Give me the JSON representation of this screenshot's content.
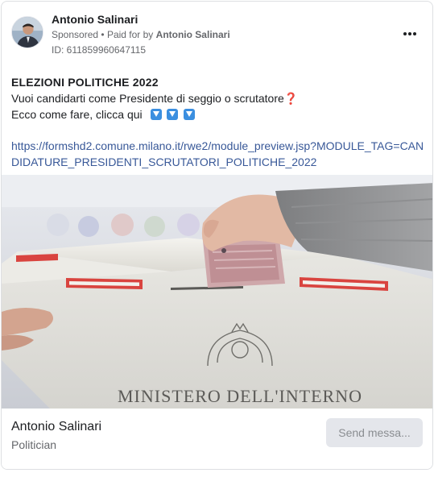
{
  "post": {
    "author_name": "Antonio Salinari",
    "sponsored_label": "Sponsored",
    "separator": "•",
    "paid_for_prefix": "Paid for by",
    "paid_for_name": "Antonio Salinari",
    "ad_id": "ID: 611859960647115",
    "more_icon": "more-horizontal-icon"
  },
  "content": {
    "title": "ELEZIONI POLITICHE 2022",
    "line1": "Vuoi candidarti come Presidente di seggio o scrutatore",
    "line1_emoji": "❓",
    "line2": "Ecco come fare, clicca qui",
    "arrow_icon": "down-arrow-emoji-icon",
    "link": "https://formshd2.comune.milano.it/rwe2/module_preview.jsp?MODULE_TAG=CANDIDATURE_PRESIDENTI_SCRUTATORI_POLITICHE_2022"
  },
  "image": {
    "stamp_text": "MINISTERO DELL'INTERNO"
  },
  "footer": {
    "page_name": "Antonio Salinari",
    "page_category": "Politician",
    "cta_label": "Send messa..."
  },
  "colors": {
    "link": "#385898",
    "cta_bg": "#e4e6eb",
    "secondary_text": "#65676b"
  }
}
